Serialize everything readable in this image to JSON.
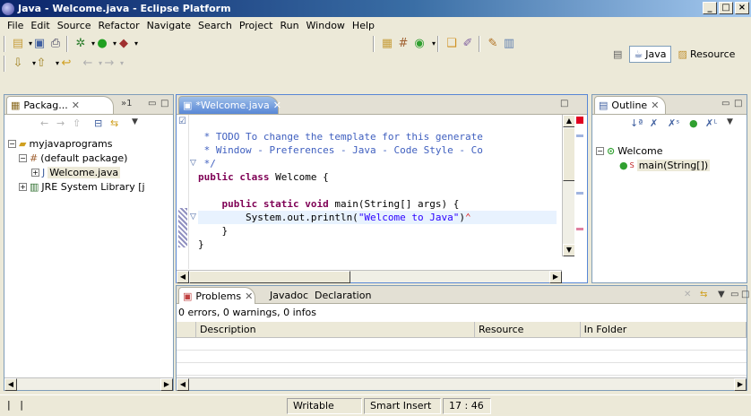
{
  "window": {
    "title": "Java - Welcome.java - Eclipse Platform",
    "min": "_",
    "max": "□",
    "close": "×"
  },
  "menu": [
    "File",
    "Edit",
    "Source",
    "Refactor",
    "Navigate",
    "Search",
    "Project",
    "Run",
    "Window",
    "Help"
  ],
  "perspectives": {
    "java": "Java",
    "resource": "Resource"
  },
  "package_explorer": {
    "tab": "Packag...",
    "overflow": "»1",
    "tree": [
      {
        "label": "myjavaprograms"
      },
      {
        "label": "(default package)"
      },
      {
        "label": "Welcome.java"
      },
      {
        "label": "JRE System Library [j"
      }
    ]
  },
  "editor": {
    "tab": "*Welcome.java",
    "lines": {
      "l1": " * TODO To change the template for this generate",
      "l2": " * Window - Preferences - Java - Code Style - Co",
      "l3": " */",
      "l4_kw": "public class",
      "l4_rest": " Welcome {",
      "l6_kw": "    public static void",
      "l6_rest": " main(String[] args) {",
      "l7_a": "        System.out.println(",
      "l7_str": "\"Welcome to Java\"",
      "l7_b": ")",
      "l8": "    }",
      "l9": "}"
    }
  },
  "outline": {
    "tab": "Outline",
    "class": "Welcome",
    "method": "main(String[])"
  },
  "problems": {
    "tabs": [
      "Problems",
      "Javadoc",
      "Declaration"
    ],
    "summary": "0 errors, 0 warnings, 0 infos",
    "columns": [
      "Description",
      "Resource",
      "In Folder"
    ]
  },
  "status": {
    "writable": "Writable",
    "insert": "Smart Insert",
    "position": "17 : 46"
  }
}
